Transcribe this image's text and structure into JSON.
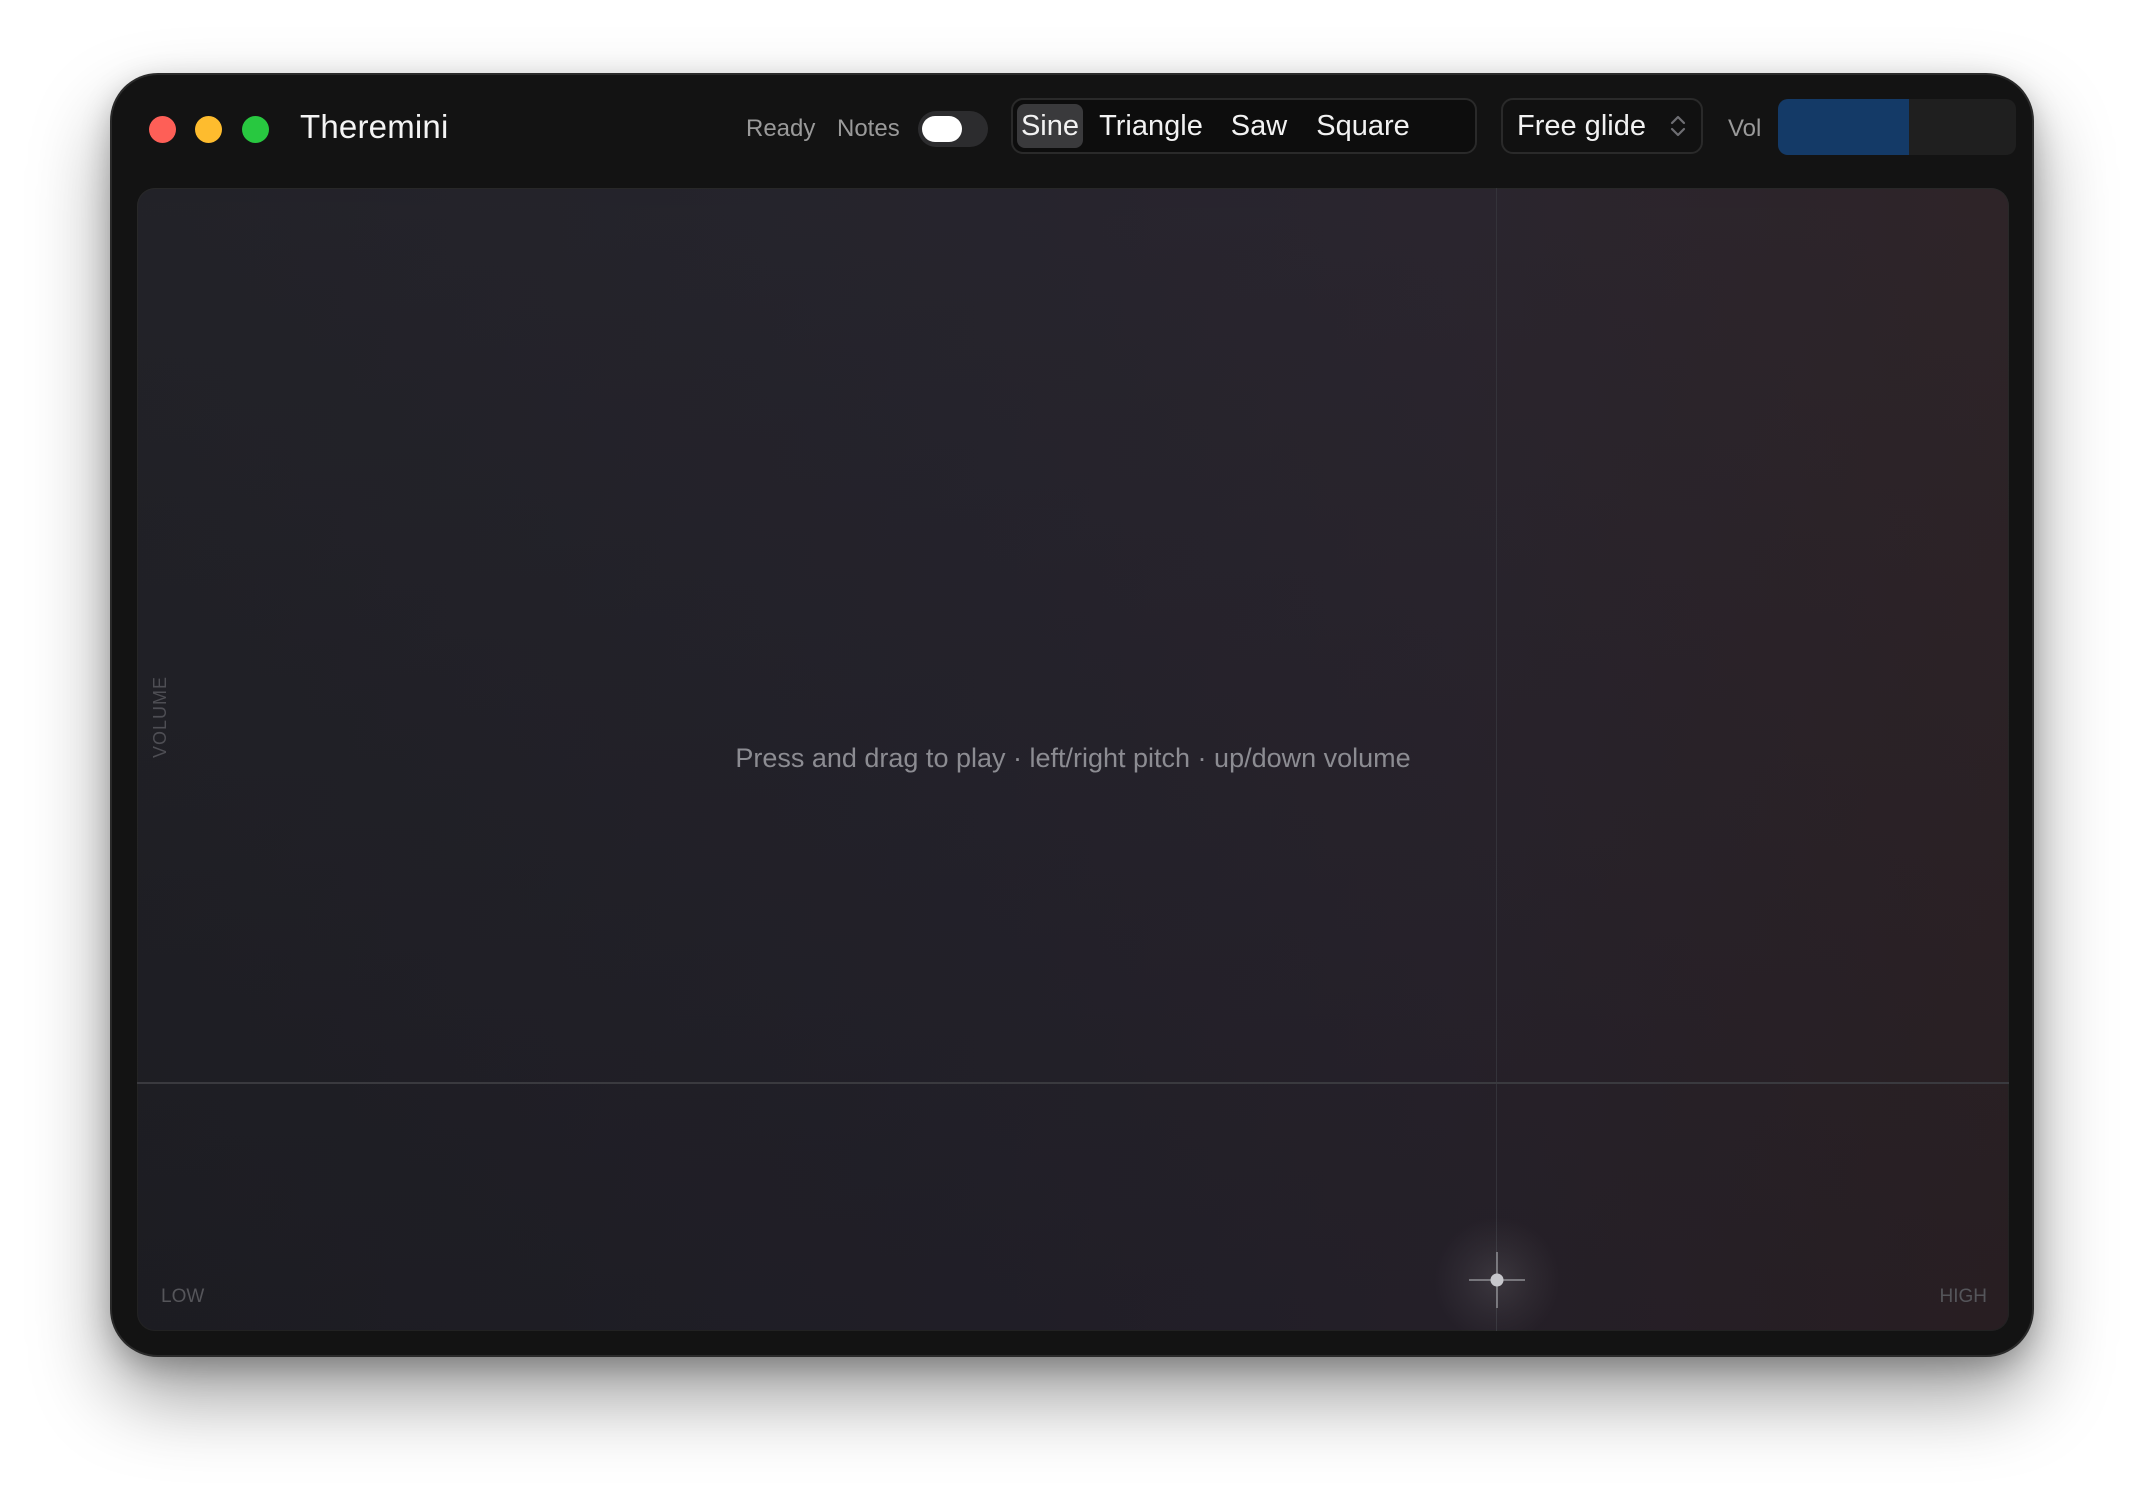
{
  "window": {
    "title": "Theremini"
  },
  "toolbar": {
    "status": "Ready",
    "notes_label": "Notes",
    "notes_enabled": false,
    "waveforms": [
      {
        "label": "Sine",
        "active": true
      },
      {
        "label": "Triangle",
        "active": false
      },
      {
        "label": "Saw",
        "active": false
      },
      {
        "label": "Square",
        "active": false
      }
    ],
    "glide": {
      "selected": "Free glide",
      "icon": "chevron-up-down-icon"
    },
    "volume": {
      "label": "Vol",
      "level": 0.55
    }
  },
  "pad": {
    "hint": "Press and drag to play · left/right pitch · up/down volume",
    "y_axis_label": "VOLUME",
    "x_low_label": "LOW",
    "x_high_label": "HIGH",
    "cursor_icon": "crosshair-icon"
  },
  "colors": {
    "close": "#fe5f57",
    "minimize": "#febc2e",
    "maximize": "#28c840",
    "volume_fill": "#143a67"
  }
}
